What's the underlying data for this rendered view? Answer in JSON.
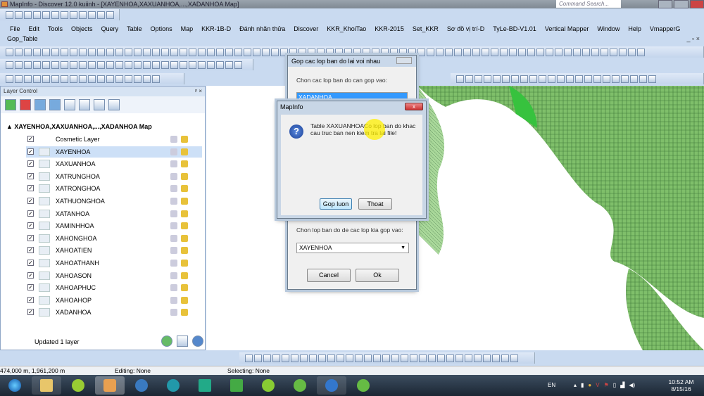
{
  "window": {
    "title": "MapInfo - Discover 12.0    kuiinh - [XAYENHOA,XAXUANHOA,...,XADANHOA Map]",
    "command_search_placeholder": "Command Search..."
  },
  "menu": [
    "File",
    "Edit",
    "Tools",
    "Objects",
    "Query",
    "Table",
    "Options",
    "Map",
    "KKR-1B-D",
    "Đánh nhãn thửa",
    "Discover",
    "KKR_KhoiTao",
    "KKR-2015",
    "Set_KKR",
    "Sơ đồ vị trí-D",
    "TyLe-BD-V1.01",
    "Vertical Mapper",
    "Window",
    "Help",
    "VmapperG"
  ],
  "submenu": "Gop_Table",
  "layer_control": {
    "title": "Layer Control",
    "root": "XAYENHOA,XAXUANHOA,...,XADANHOA Map",
    "layers": [
      {
        "name": "Cosmetic Layer",
        "checked": true,
        "selected": false
      },
      {
        "name": "XAYENHOA",
        "checked": true,
        "selected": true
      },
      {
        "name": "XAXUANHOA",
        "checked": true,
        "selected": false
      },
      {
        "name": "XATRUNGHOA",
        "checked": true,
        "selected": false
      },
      {
        "name": "XATRONGHOA",
        "checked": true,
        "selected": false
      },
      {
        "name": "XATHUONGHOA",
        "checked": true,
        "selected": false
      },
      {
        "name": "XATANHOA",
        "checked": true,
        "selected": false
      },
      {
        "name": "XAMINHHOA",
        "checked": true,
        "selected": false
      },
      {
        "name": "XAHONGHOA",
        "checked": true,
        "selected": false
      },
      {
        "name": "XAHOATIEN",
        "checked": true,
        "selected": false
      },
      {
        "name": "XAHOATHANH",
        "checked": true,
        "selected": false
      },
      {
        "name": "XAHOASON",
        "checked": true,
        "selected": false
      },
      {
        "name": "XAHOAPHUC",
        "checked": true,
        "selected": false
      },
      {
        "name": "XAHOAHOP",
        "checked": true,
        "selected": false
      },
      {
        "name": "XADANHOA",
        "checked": true,
        "selected": false
      }
    ],
    "status": "Updated 1 layer"
  },
  "merge_dialog": {
    "title": "Gop cac lop ban do lai voi nhau",
    "label_source": "Chon cac lop ban do can gop vao:",
    "selected_source": "XADANHOA",
    "label_target": "Chon lop ban do de cac lop kia gop vao:",
    "target_value": "XAYENHOA",
    "cancel": "Cancel",
    "ok": "Ok"
  },
  "message_box": {
    "title": "MapInfo",
    "message": "Table XAXUANHOACo lop ban do khac cau truc ban nen kiem tra lai file!",
    "btn_merge": "Gop luon",
    "btn_exit": "Thoat"
  },
  "statusbar": {
    "coords": "474,000 m, 1,961,200 m",
    "editing": "Editing: None",
    "selecting": "Selecting: None"
  },
  "tray": {
    "lang": "EN",
    "time": "10:52 AM",
    "date": "8/15/16"
  }
}
